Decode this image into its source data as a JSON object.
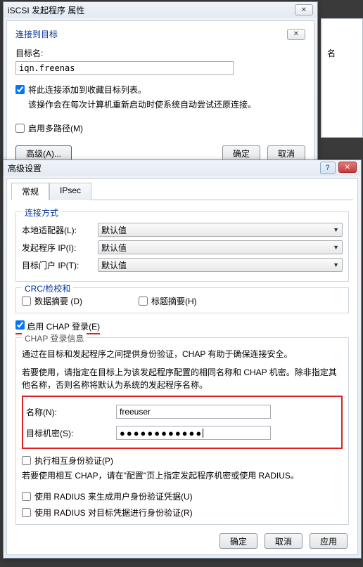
{
  "bg_label": "名",
  "dialog1": {
    "title": "iSCSI 发起程序 属性",
    "panel_title": "连接到目标",
    "target_label": "目标名:",
    "target_value": "iqn.freenas",
    "chk_favorite": "将此连接添加到收藏目标列表。",
    "favorite_note": "该操作会在每次计算机重新启动时使系统自动尝试还原连接。",
    "chk_multipath": "启用多路径(M)",
    "btn_advanced": "高级(A)...",
    "btn_ok": "确定",
    "btn_cancel": "取消"
  },
  "dialog2": {
    "title": "高级设置",
    "tabs": {
      "general": "常规",
      "ipsec": "IPsec"
    },
    "connect_group": "连接方式",
    "local_adapter": "本地适配器(L):",
    "initiator_ip": "发起程序 IP(I):",
    "target_portal": "目标门户 IP(T):",
    "default_value": "默认值",
    "crc_group": "CRC/检校和",
    "chk_data_digest": "数据摘要 (D)",
    "chk_header_digest": "标题摘要(H)",
    "chk_chap": "启用 CHAP 登录(E)",
    "chap_group": "CHAP 登录信息",
    "chap_note1": "通过在目标和发起程序之间提供身份验证，CHAP 有助于确保连接安全。",
    "chap_note2": "若要使用，请指定在目标上为该发起程序配置的相同名称和 CHAP 机密。除非指定其他名称，否则名称将默认为系统的发起程序名称。",
    "name_label": "名称(N):",
    "name_value": "freeuser",
    "secret_label": "目标机密(S):",
    "secret_value": "●●●●●●●●●●●●",
    "chk_mutual": "执行相互身份验证(P)",
    "mutual_note": "若要使用相互 CHAP，请在\"配置\"页上指定发起程序机密或使用 RADIUS。",
    "chk_radius_user": "使用 RADIUS 来生成用户身份验证凭据(U)",
    "chk_radius_target": "使用 RADIUS 对目标凭据进行身份验证(R)",
    "btn_ok": "确定",
    "btn_cancel": "取消",
    "btn_apply": "应用"
  }
}
